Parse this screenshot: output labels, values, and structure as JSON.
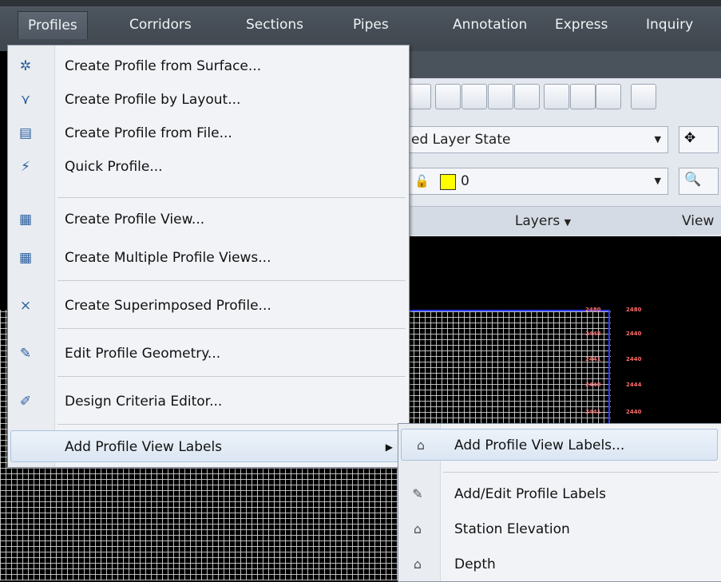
{
  "menubar": {
    "items": [
      "Profiles",
      "Corridors",
      "Sections",
      "Pipes",
      "Annotation",
      "Express",
      "Inquiry"
    ]
  },
  "ribbon": {
    "layer_state": "ed Layer State",
    "layer_value": "0",
    "layers_label": "Layers",
    "view_label": "View",
    "layer_color": "#ffff00"
  },
  "profiles_menu": {
    "items": [
      {
        "label": "Create Profile from Surface...",
        "icon": "profile-from-surface-icon"
      },
      {
        "label": "Create Profile by Layout...",
        "icon": "profile-layout-icon"
      },
      {
        "label": "Create Profile from File...",
        "icon": "profile-from-file-icon"
      },
      {
        "label": "Quick Profile...",
        "icon": "quick-profile-icon"
      },
      {
        "label": "Create Profile View...",
        "icon": "profile-view-icon"
      },
      {
        "label": "Create Multiple Profile Views...",
        "icon": "multiple-profile-views-icon"
      },
      {
        "label": "Create Superimposed Profile...",
        "icon": "superimposed-profile-icon"
      },
      {
        "label": "Edit Profile Geometry...",
        "icon": "edit-geometry-icon"
      },
      {
        "label": "Design Criteria Editor...",
        "icon": "design-criteria-icon"
      },
      {
        "label": "Add Profile View Labels",
        "icon": ""
      }
    ]
  },
  "sub_menu": {
    "items": [
      {
        "label": "Add Profile View Labels...",
        "icon": "tag-icon"
      },
      {
        "label": "Add/Edit Profile Labels",
        "icon": "tag-edit-icon"
      },
      {
        "label": "Station Elevation",
        "icon": "tag-icon"
      },
      {
        "label": "Depth",
        "icon": "tag-icon"
      }
    ]
  },
  "cad": {
    "labels_left": [
      "2480",
      "2448",
      "2441",
      "2448",
      "2441"
    ],
    "labels_right": [
      "2480",
      "2440",
      "2440",
      "2444",
      "2440"
    ]
  }
}
